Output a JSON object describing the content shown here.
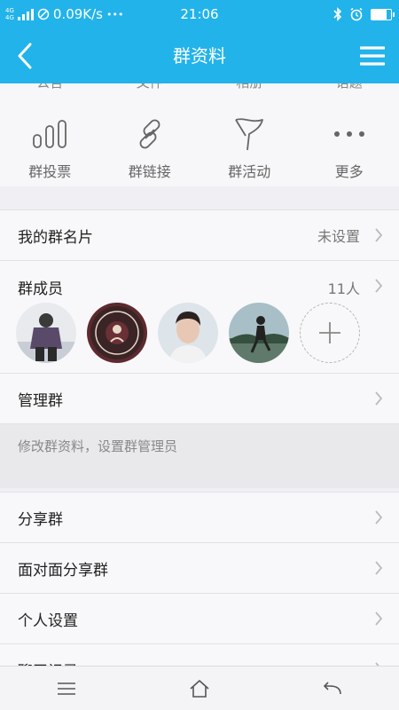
{
  "status_bar": {
    "network_top": "4G",
    "network_bottom": "4G",
    "speed": "0.09K/s",
    "dots": "•••",
    "time": "21:06",
    "battery_level": 0.75
  },
  "nav": {
    "title": "群资料",
    "back_icon": "chevron-left-icon",
    "menu_icon": "hamburger-menu-icon"
  },
  "tools": {
    "cut_labels": [
      "公告",
      "文件",
      "相册",
      "话题"
    ],
    "items": [
      {
        "label": "群投票",
        "icon": "bar-chart-icon"
      },
      {
        "label": "群链接",
        "icon": "link-icon"
      },
      {
        "label": "群活动",
        "icon": "flag-icon"
      },
      {
        "label": "更多",
        "icon": "more-dots-icon"
      }
    ]
  },
  "card": {
    "label": "我的群名片",
    "value": "未设置"
  },
  "members": {
    "label": "群成员",
    "count": "11人"
  },
  "manage": {
    "label": "管理群",
    "note": "修改群资料，设置群管理员"
  },
  "list": [
    {
      "label": "分享群"
    },
    {
      "label": "面对面分享群"
    },
    {
      "label": "个人设置"
    },
    {
      "label": "聊天记录"
    }
  ],
  "colors": {
    "accent": "#22b3ea",
    "background": "#efeff4"
  }
}
